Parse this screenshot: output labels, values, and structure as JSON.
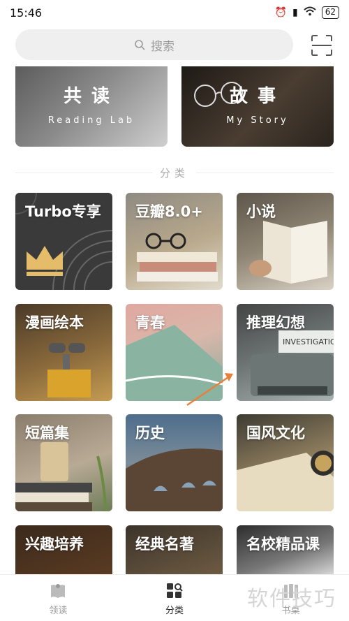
{
  "status_bar": {
    "time": "15:46",
    "battery": "62"
  },
  "search": {
    "placeholder": "搜索"
  },
  "banners": [
    {
      "title": "共读",
      "subtitle": "Reading Lab"
    },
    {
      "title": "故事",
      "subtitle": "My Story"
    }
  ],
  "section": {
    "title": "分类"
  },
  "categories": [
    "Turbo专享",
    "豆瓣8.0+",
    "小说",
    "漫画绘本",
    "青春",
    "推理幻想",
    "短篇集",
    "历史",
    "国风文化",
    "兴趣培养",
    "经典名著",
    "名校精品课"
  ],
  "tile_extra": {
    "typewriter_text": "INVESTIGATIO"
  },
  "nav": {
    "items": [
      "领读",
      "分类",
      "书桌"
    ],
    "active_index": 1
  },
  "watermark": "软件技巧",
  "colors": {
    "annotation_arrow": "#e8803a"
  }
}
